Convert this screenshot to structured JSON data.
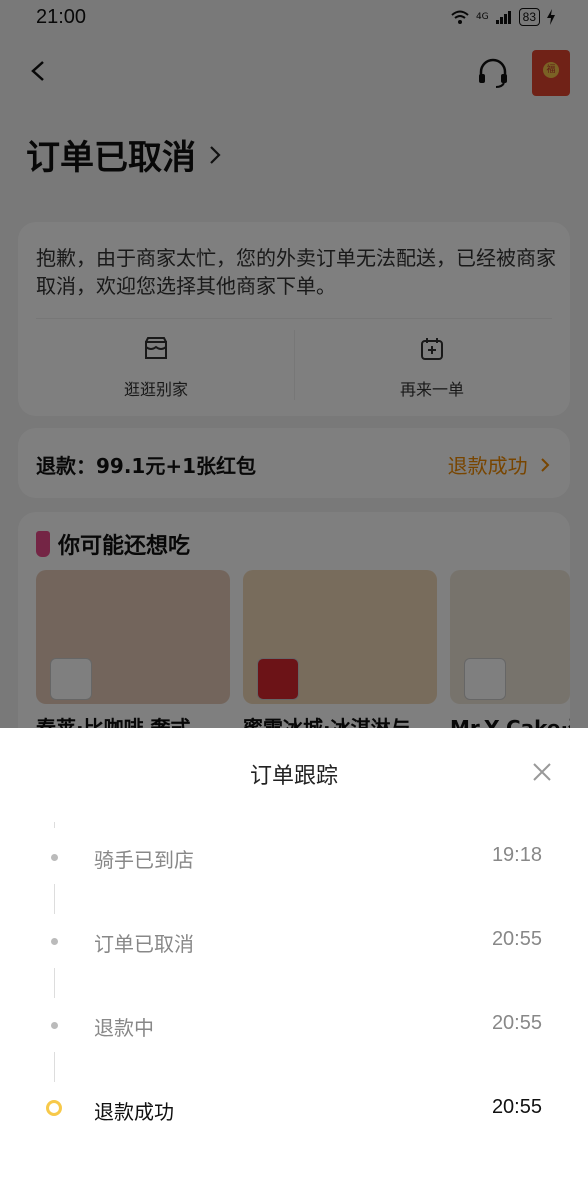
{
  "status_bar": {
    "time": "21:00",
    "network": "4G",
    "battery": "83"
  },
  "nav": {
    "back_icon": "chevron-left-icon",
    "support_icon": "headset-icon",
    "red_packet_char": "福"
  },
  "order": {
    "status_title": "订单已取消",
    "notice": "抱歉，由于商家太忙，您的外卖订单无法配送，已经被商家取消，欢迎您选择其他商家下单。",
    "actions": [
      {
        "label": "逛逛别家",
        "icon": "shop-icon"
      },
      {
        "label": "再来一单",
        "icon": "reorder-icon"
      }
    ],
    "refund_label": "退款：99.1元+1张红包",
    "refund_status": "退款成功"
  },
  "recommendations": {
    "title": "你可能还想吃",
    "items": [
      {
        "name": "春莱·比咖啡 奢式"
      },
      {
        "name": "蜜雪冰城·冰淇淋与"
      },
      {
        "name": "Mr.Y Cake·蛋糕"
      }
    ]
  },
  "tracking_sheet": {
    "title": "订单跟踪",
    "steps": [
      {
        "label": "骑手已到店",
        "time": "19:18",
        "active": false
      },
      {
        "label": "订单已取消",
        "time": "20:55",
        "active": false
      },
      {
        "label": "退款中",
        "time": "20:55",
        "active": false
      },
      {
        "label": "退款成功",
        "time": "20:55",
        "active": true
      }
    ]
  },
  "colors": {
    "accent_orange": "#f08a00",
    "active_dot": "#f7c94a",
    "red_packet": "#e0452e"
  }
}
